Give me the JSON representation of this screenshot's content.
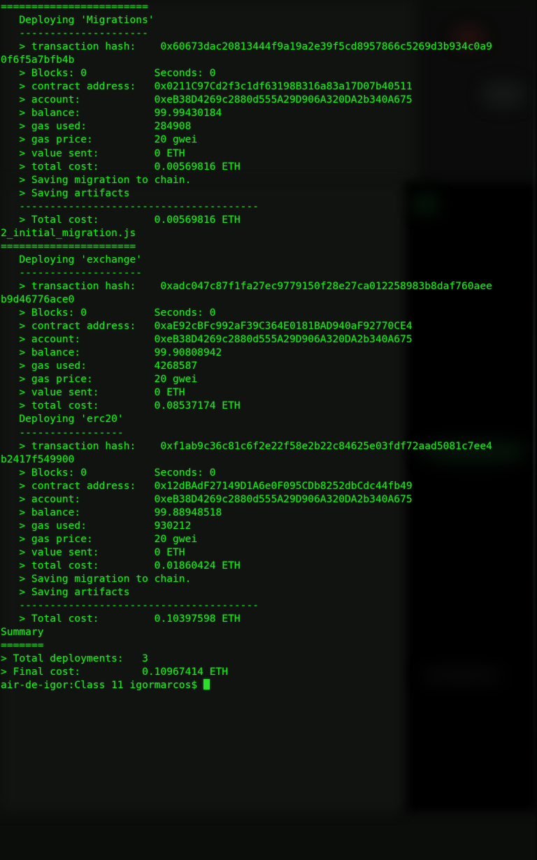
{
  "terminal": {
    "window_title": "Terminal — truffle migrate",
    "foreground_color": "#24e024",
    "background_color": "#0b0d0b",
    "cursor_color": "#2ae02a",
    "prompt": "air-de-igor:Class 11 igormarcos$",
    "cursor_glyph": "block-cursor"
  },
  "output_lines": [
    "========================",
    "",
    "   Deploying 'Migrations'",
    "   ---------------------",
    "   > transaction hash:    0x60673dac20813444f9a19a2e39f5cd8957866c5269d3b934c0a9",
    "0f6f5a7bfb4b",
    "   > Blocks: 0           Seconds: 0",
    "   > contract address:   0x0211C97Cd2f3c1df63198B316a83a17D07b40511",
    "   > account:            0xeB38D4269c2880d555A29D906A320DA2b340A675",
    "   > balance:            99.99430184",
    "   > gas used:           284908",
    "   > gas price:          20 gwei",
    "   > value sent:         0 ETH",
    "   > total cost:         0.00569816 ETH",
    "",
    "",
    "   > Saving migration to chain.",
    "   > Saving artifacts",
    "   ---------------------------------------",
    "   > Total cost:         0.00569816 ETH",
    "",
    "",
    "2_initial_migration.js",
    "======================",
    "",
    "   Deploying 'exchange'",
    "   --------------------",
    "   > transaction hash:    0xadc047c87f1fa27ec9779150f28e27ca012258983b8daf760aee",
    "b9d46776ace0",
    "   > Blocks: 0           Seconds: 0",
    "   > contract address:   0xaE92cBFc992aF39C364E0181BAD940aF92770CE4",
    "   > account:            0xeB38D4269c2880d555A29D906A320DA2b340A675",
    "   > balance:            99.90808942",
    "   > gas used:           4268587",
    "   > gas price:          20 gwei",
    "   > value sent:         0 ETH",
    "   > total cost:         0.08537174 ETH",
    "",
    "",
    "   Deploying 'erc20'",
    "   -----------------",
    "   > transaction hash:    0xf1ab9c36c81c6f2e22f58e2b22c84625e03fdf72aad5081c7ee4",
    "b2417f549900",
    "   > Blocks: 0           Seconds: 0",
    "   > contract address:   0x12dBAdF27149D1A6e0F095CDb8252dbCdc44fb49",
    "   > account:            0xeB38D4269c2880d555A29D906A320DA2b340A675",
    "   > balance:            99.88948518",
    "   > gas used:           930212",
    "   > gas price:          20 gwei",
    "   > value sent:         0 ETH",
    "   > total cost:         0.01860424 ETH",
    "",
    "",
    "   > Saving migration to chain.",
    "   > Saving artifacts",
    "   ---------------------------------------",
    "   > Total cost:         0.10397598 ETH",
    "",
    "",
    "Summary",
    "=======",
    "> Total deployments:   3",
    "> Final cost:          0.10967414 ETH",
    ""
  ],
  "migrations": [
    {
      "file": "2_initial_migration.js",
      "contracts": [
        {
          "name": "Migrations",
          "transaction_hash": "0x60673dac20813444f9a19a2e39f5cd8957866c5269d3b934c0a90f6f5a7bfb4b",
          "blocks": "0",
          "seconds": "0",
          "contract_address": "0x0211C97Cd2f3c1df63198B316a83a17D07b40511",
          "account": "0xeB38D4269c2880d555A29D906A320DA2b340A675",
          "balance": "99.99430184",
          "gas_used": "284908",
          "gas_price": "20 gwei",
          "value_sent": "0 ETH",
          "total_cost": "0.00569816 ETH"
        },
        {
          "name": "exchange",
          "transaction_hash": "0xadc047c87f1fa27ec9779150f28e27ca012258983b8daf760aeeb9d46776ace0",
          "blocks": "0",
          "seconds": "0",
          "contract_address": "0xaE92cBFc992aF39C364E0181BAD940aF92770CE4",
          "account": "0xeB38D4269c2880d555A29D906A320DA2b340A675",
          "balance": "99.90808942",
          "gas_used": "4268587",
          "gas_price": "20 gwei",
          "value_sent": "0 ETH",
          "total_cost": "0.08537174 ETH"
        },
        {
          "name": "erc20",
          "transaction_hash": "0xf1ab9c36c81c6f2e22f58e2b22c84625e03fdf72aad5081c7ee4b2417f549900",
          "blocks": "0",
          "seconds": "0",
          "contract_address": "0x12dBAdF27149D1A6e0F095CDb8252dbCdc44fb49",
          "account": "0xeB38D4269c2880d555A29D906A320DA2b340A675",
          "balance": "99.88948518",
          "gas_used": "930212",
          "gas_price": "20 gwei",
          "value_sent": "0 ETH",
          "total_cost": "0.01860424 ETH"
        }
      ],
      "migration_total_cost": "0.10397598 ETH"
    }
  ],
  "summary": {
    "heading": "Summary",
    "underline": "=======",
    "total_deployments_label": "> Total deployments:",
    "total_deployments_value": "3",
    "final_cost_label": "> Final cost:",
    "final_cost_value": "0.10967414 ETH"
  }
}
